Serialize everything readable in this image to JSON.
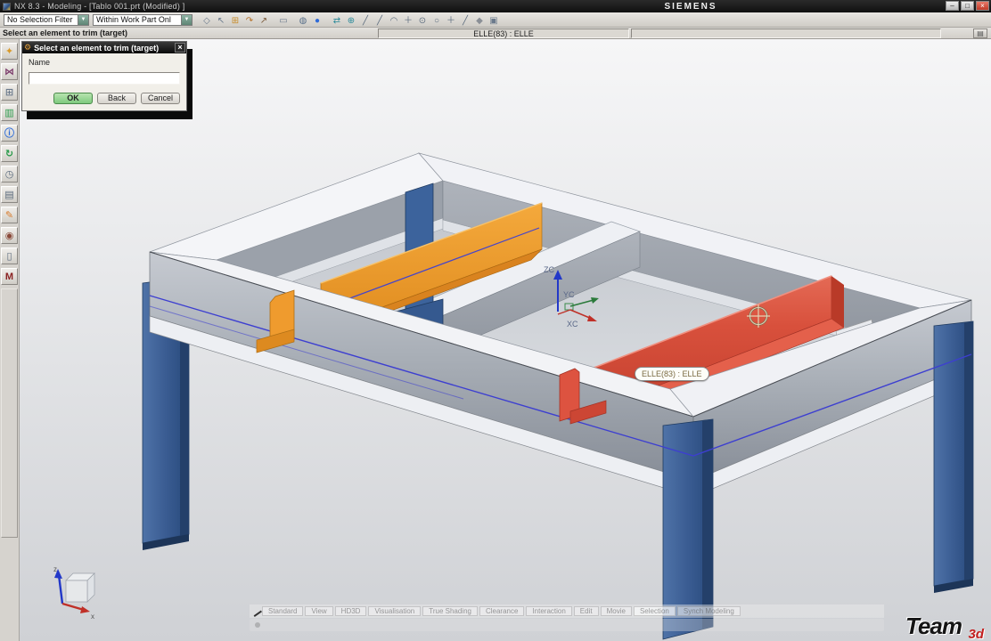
{
  "window": {
    "title": "NX 8.3 - Modeling - [Tablo 001.prt (Modified) ]",
    "brand": "SIEMENS",
    "minimize": "–",
    "restore": "□",
    "close": "×"
  },
  "toolbar": {
    "selection_filter": "No Selection Filter",
    "scope": "Within Work Part Onl",
    "caret": "▼",
    "icons": [
      {
        "name": "snap-point-icon",
        "glyph": "◇",
        "color": "#6b7a8c"
      },
      {
        "name": "select-arrow-icon",
        "glyph": "↖",
        "color": "#6b7a8c"
      },
      {
        "name": "point-dialog-icon",
        "glyph": "⊞",
        "color": "#c78c2a"
      },
      {
        "name": "reorient-icon",
        "glyph": "↷",
        "color": "#b5722a"
      },
      {
        "name": "move-arrow-icon",
        "glyph": "↗",
        "color": "#7a5a3a"
      },
      {
        "name": "marquee-select-icon",
        "glyph": "▭",
        "color": "#6b7a8c"
      },
      {
        "name": "visibility-icon",
        "glyph": "◍",
        "color": "#5a708a"
      },
      {
        "name": "shaded-sphere-icon",
        "glyph": "●",
        "color": "#2f6bd8"
      },
      {
        "name": "pan-view-icon",
        "glyph": "⇄",
        "color": "#2a8a9a"
      },
      {
        "name": "zoom-view-icon",
        "glyph": "⊕",
        "color": "#2a8a9a"
      },
      {
        "name": "line-tool-icon",
        "glyph": "╱",
        "color": "#5b6b7d"
      },
      {
        "name": "line2-tool-icon",
        "glyph": "╱",
        "color": "#5b6b7d"
      },
      {
        "name": "arc-tool-icon",
        "glyph": "◠",
        "color": "#5b6b7d"
      },
      {
        "name": "point-tool-icon",
        "glyph": "＋",
        "color": "#5b6b7d"
      },
      {
        "name": "circle-center-tool-icon",
        "glyph": "⊙",
        "color": "#5b6b7d"
      },
      {
        "name": "circle-tool-icon",
        "glyph": "○",
        "color": "#5b6b7d"
      },
      {
        "name": "plus-tool-icon",
        "glyph": "＋",
        "color": "#5b6b7d"
      },
      {
        "name": "slash-tool-icon",
        "glyph": "╱",
        "color": "#5b6b7d"
      },
      {
        "name": "blob-tool-icon",
        "glyph": "◆",
        "color": "#8a8f96"
      },
      {
        "name": "profile-tool-icon",
        "glyph": "▣",
        "color": "#6b7a8c"
      }
    ]
  },
  "cue": {
    "prompt": "Select an element to trim (target)",
    "status": "ELLE(83) : ELLE"
  },
  "dialog": {
    "title": "Select an element to trim (target)",
    "icon": "⚙",
    "close": "×",
    "name_label": "Name",
    "input_value": "",
    "ok": "OK",
    "back": "Back",
    "cancel": "Cancel"
  },
  "sidebar": {
    "icons": [
      {
        "name": "selection-hand-icon",
        "glyph": "✦",
        "color": "#d89a2a"
      },
      {
        "name": "bowtie-transition-icon",
        "glyph": "⋈",
        "color": "#7a3a6a"
      },
      {
        "name": "dialog-grid-icon",
        "glyph": "⊞",
        "color": "#6b7a8c"
      },
      {
        "name": "library-books-icon",
        "glyph": "▥",
        "color": "#2a9a4a"
      },
      {
        "name": "info-sphere-icon",
        "glyph": "ⓘ",
        "color": "#2a6ad8"
      },
      {
        "name": "sync-refresh-icon",
        "glyph": "↻",
        "color": "#2a9a4a"
      },
      {
        "name": "history-clock-icon",
        "glyph": "◷",
        "color": "#5b6b7d"
      },
      {
        "name": "list-panel-icon",
        "glyph": "▤",
        "color": "#5b6b7d"
      },
      {
        "name": "pencil-edit-icon",
        "glyph": "✎",
        "color": "#d87a2a"
      },
      {
        "name": "people-roles-icon",
        "glyph": "◉",
        "color": "#8a4a3a"
      },
      {
        "name": "note-page-icon",
        "glyph": "▯",
        "color": "#5b6b7d"
      },
      {
        "name": "materials-m-icon",
        "glyph": "M",
        "color": "#8a2222"
      }
    ]
  },
  "viewport": {
    "tooltip": "ELLE(83) : ELLE",
    "wcs": {
      "zc": "ZC",
      "yc": "YC",
      "xc": "XC"
    },
    "triad": {
      "z": "z",
      "x": "x"
    }
  },
  "bottom_bar": {
    "segments": [
      "Standard",
      "View",
      "HD3D",
      "Visualisation",
      "True Shading",
      "Clearance",
      "Interaction",
      "Edit",
      "Movie",
      "Selection",
      "Synch Modeling"
    ]
  },
  "watermark": {
    "team": "Team",
    "threed": "3d"
  },
  "colors": {
    "ok_green": "#7ec97e",
    "leg_blue": "#3a5c92",
    "beam_orange": "#ee9a2d",
    "beam_red": "#d8503c",
    "sketch_blue": "#3d3fd0",
    "title_bg": "#141414"
  }
}
